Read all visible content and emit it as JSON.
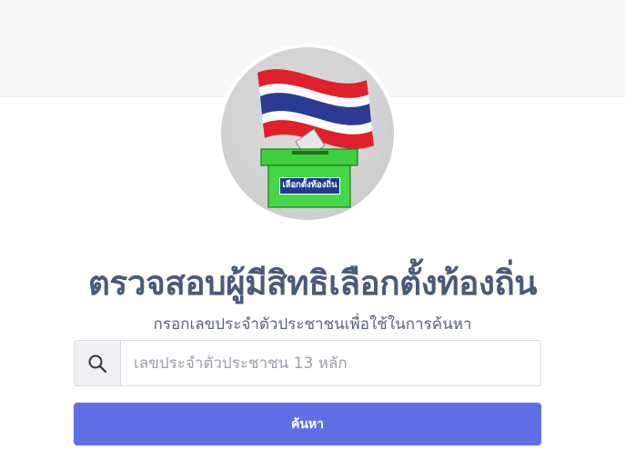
{
  "logo": {
    "ballot_label": "เลือกตั้งท้องถิ่น",
    "flag_colors": [
      "#e0202b",
      "#ffffff",
      "#2c3a94"
    ],
    "ballot_box_color": "#3fcf3f"
  },
  "page": {
    "title": "ตรวจสอบผู้มีสิทธิเลือกตั้งท้องถิ่น",
    "subtitle": "กรอกเลขประจำตัวประชาชนเพื่อใช้ในการค้นหา"
  },
  "search": {
    "icon": "search-icon",
    "placeholder": "เลขประจำตัวประชาชน 13 หลัก",
    "value": "",
    "button_label": "ค้นหา",
    "button_color": "#5f6fe3"
  }
}
